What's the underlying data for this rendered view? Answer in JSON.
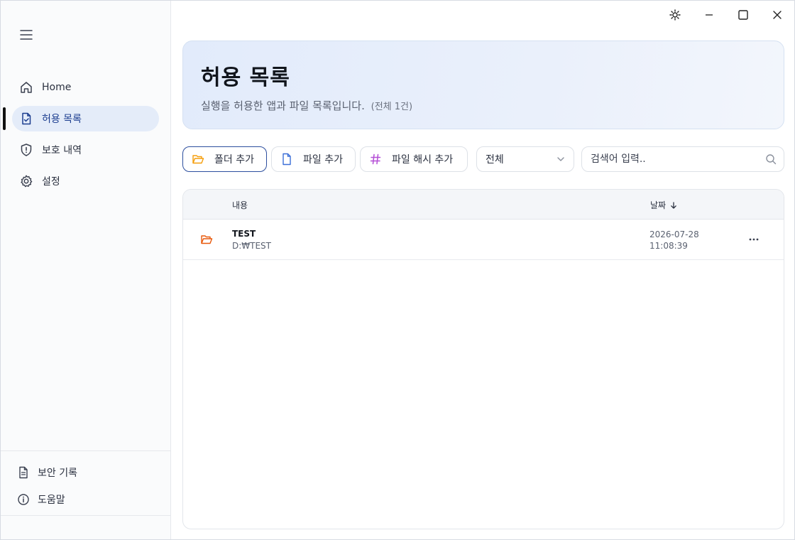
{
  "sidebar": {
    "nav": [
      {
        "label": "Home",
        "icon": "home-icon",
        "active": false
      },
      {
        "label": "허용 목록",
        "icon": "file-check-icon",
        "active": true
      },
      {
        "label": "보호 내역",
        "icon": "shield-alert-icon",
        "active": false
      },
      {
        "label": "설정",
        "icon": "gear-icon",
        "active": false
      }
    ],
    "bottom": [
      {
        "label": "보안 기록",
        "icon": "document-icon"
      },
      {
        "label": "도움말",
        "icon": "info-icon"
      }
    ]
  },
  "header": {
    "title": "허용 목록",
    "subtitle": "실행을 허용한 앱과 파일 목록입니다.",
    "count": "(전체 1건)"
  },
  "toolbar": {
    "add_folder": "폴더 추가",
    "add_file": "파일 추가",
    "add_hash": "파일 해시 추가",
    "filter_value": "전체",
    "search_placeholder": "검색어 입력.."
  },
  "table": {
    "col_content": "내용",
    "col_date": "날짜",
    "rows": [
      {
        "name": "TEST",
        "path": "D:₩TEST",
        "date": "2026-07-28",
        "time": "11:08:39"
      }
    ]
  },
  "colors": {
    "accent": "#2c4e9e",
    "active_nav_bg": "#e4ecf9",
    "folder_icon": "#f59e0b",
    "folder_icon_row": "#e8590c",
    "file_icon": "#3b6fd8",
    "hash_icon": "#b44fd6"
  }
}
